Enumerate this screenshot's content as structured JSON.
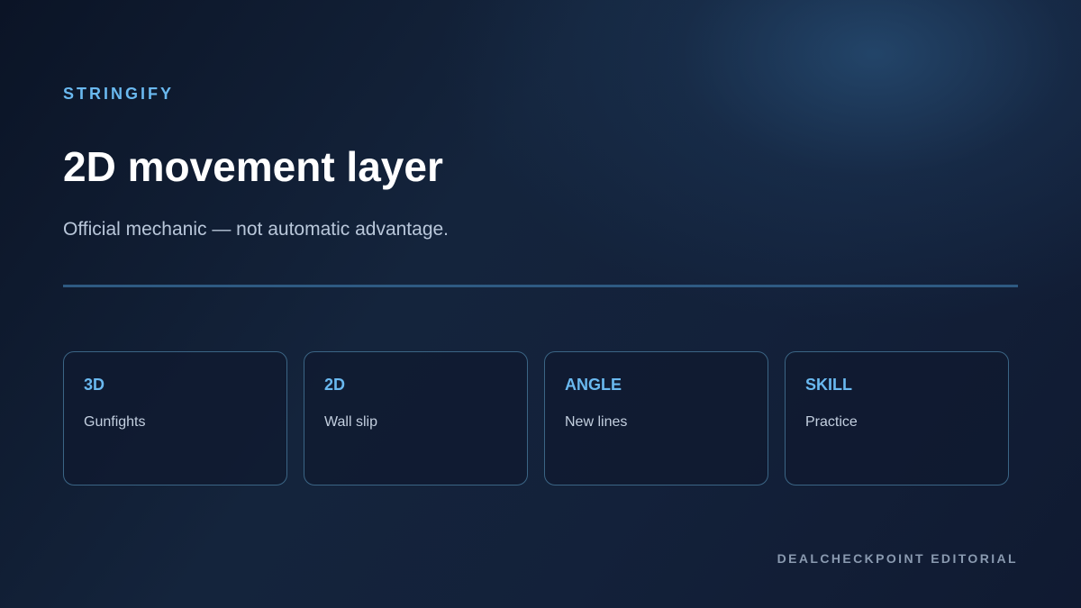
{
  "header": {
    "brand": "STRINGIFY",
    "title": "2D movement layer",
    "subtitle": "Official mechanic — not automatic advantage."
  },
  "cards": [
    {
      "label": "3D",
      "description": "Gunfights"
    },
    {
      "label": "2D",
      "description": "Wall slip"
    },
    {
      "label": "ANGLE",
      "description": "New lines"
    },
    {
      "label": "SKILL",
      "description": "Practice"
    }
  ],
  "footer": {
    "credit": "DEALCHECKPOINT EDITORIAL"
  },
  "colors": {
    "accent": "#6ab9f0",
    "background": "#13213a",
    "divider": "#2e5a82",
    "card_border": "#3b6585"
  }
}
